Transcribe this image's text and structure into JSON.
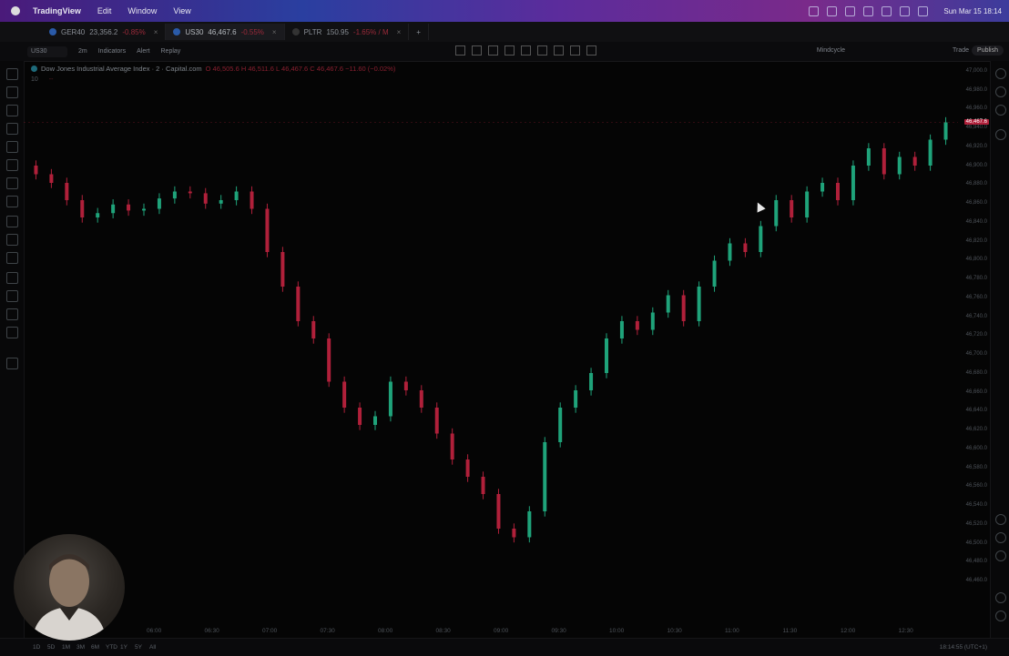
{
  "menubar": {
    "app_name": "TradingView",
    "menu_items": [
      "Edit",
      "Window",
      "View"
    ],
    "clock": "Sun Mar 15  18:14"
  },
  "tabs": [
    {
      "symbol": "GER40",
      "price": "23,356.2",
      "change": "-0.85%"
    },
    {
      "symbol": "US30",
      "price": "46,467.6",
      "change": "-0.55%"
    },
    {
      "symbol": "PLTR",
      "price": "150.95",
      "change": "-1.65% / M"
    }
  ],
  "toolbar": {
    "symbol": "US30",
    "interval": "2m",
    "indicators": "Indicators",
    "alert": "Alert",
    "replay": "Replay",
    "mindcycle": "Mindcycle",
    "trade": "Trade",
    "publish": "Publish"
  },
  "legend": {
    "title": "Dow Jones Industrial Average Index · 2 · Capital.com",
    "ohlc": "O 46,505.6  H 46,511.6  L 46,467.6  C 46,467.6  −11.60 (−0.02%)",
    "volume_label": "10",
    "volume_value": "--"
  },
  "colors": {
    "up": "#1fa37a",
    "down": "#b0203a",
    "bg": "#050505"
  },
  "chart_data": {
    "type": "candlestick",
    "x": [
      "06:00",
      "06:30",
      "07:00",
      "07:30",
      "08:00",
      "08:30",
      "09:00",
      "09:30",
      "10:00",
      "10:30",
      "11:00",
      "11:30",
      "12:00",
      "12:30"
    ],
    "ylim": [
      46400,
      47000
    ],
    "y_ticks": [
      "47,000.0",
      "46,980.0",
      "46,960.0",
      "46,940.0",
      "46,920.0",
      "46,900.0",
      "46,880.0",
      "46,860.0",
      "46,840.0",
      "46,820.0",
      "46,800.0",
      "46,780.0",
      "46,760.0",
      "46,740.0",
      "46,720.0",
      "46,700.0",
      "46,680.0",
      "46,660.0",
      "46,640.0",
      "46,620.0",
      "46,600.0",
      "46,580.0",
      "46,560.0",
      "46,540.0",
      "46,520.0",
      "46,500.0",
      "46,480.0",
      "46,460.0"
    ],
    "current_price": "46,467.6",
    "series": [
      46890,
      46880,
      46860,
      46840,
      46845,
      46855,
      46848,
      46850,
      46862,
      46870,
      46868,
      46856,
      46860,
      46870,
      46850,
      46800,
      46760,
      46720,
      46700,
      46650,
      46620,
      46600,
      46610,
      46650,
      46640,
      46620,
      46590,
      46560,
      46540,
      46520,
      46480,
      46470,
      46500,
      46580,
      46620,
      46640,
      46660,
      46700,
      46720,
      46710,
      46730,
      46750,
      46720,
      46760,
      46790,
      46810,
      46800,
      46830,
      46860,
      46840,
      46870,
      46880,
      46860,
      46900,
      46920,
      46890,
      46910,
      46900,
      46930,
      46950
    ]
  },
  "periods": [
    "1D",
    "5D",
    "1M",
    "3M",
    "6M",
    "YTD",
    "1Y",
    "5Y",
    "All"
  ],
  "timezone": "18:14:55 (UTC+1)"
}
